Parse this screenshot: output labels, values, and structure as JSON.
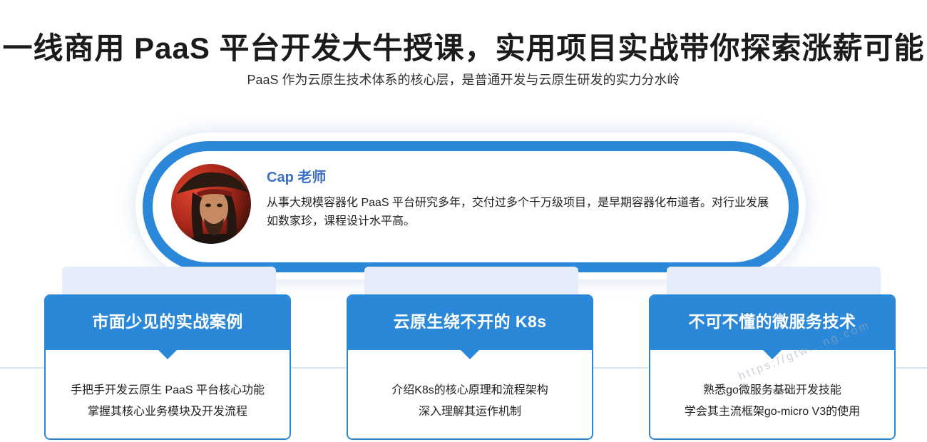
{
  "header": {
    "title": "一线商用 PaaS 平台开发大牛授课，实用项目实战带你探索涨薪可能",
    "subtitle": "PaaS 作为云原生技术体系的核心层，是普通开发与云原生研发的实力分水岭"
  },
  "instructor": {
    "name": "Cap 老师",
    "bio": "从事大规模容器化 PaaS 平台研究多年，交付过多个千万级项目，是早期容器化布道者。对行业发展如数家珍，课程设计水平高。",
    "avatar_icon": "pirate-portrait"
  },
  "cards": [
    {
      "title": "市面少见的实战案例",
      "lines": [
        "手把手开发云原生 PaaS 平台核心功能",
        "掌握其核心业务模块及开发流程"
      ]
    },
    {
      "title": "云原生绕不开的 K8s",
      "lines": [
        "介绍K8s的核心原理和流程架构",
        "深入理解其运作机制"
      ]
    },
    {
      "title": "不可不懂的微服务技术",
      "lines": [
        "熟悉go微服务基础开发技能",
        "学会其主流框架go-micro V3的使用"
      ]
    }
  ],
  "watermark": "https://gtw...ng.com",
  "colors": {
    "accent": "#2b88d8",
    "name": "#3a6fc4",
    "tab": "#e4edf9"
  }
}
